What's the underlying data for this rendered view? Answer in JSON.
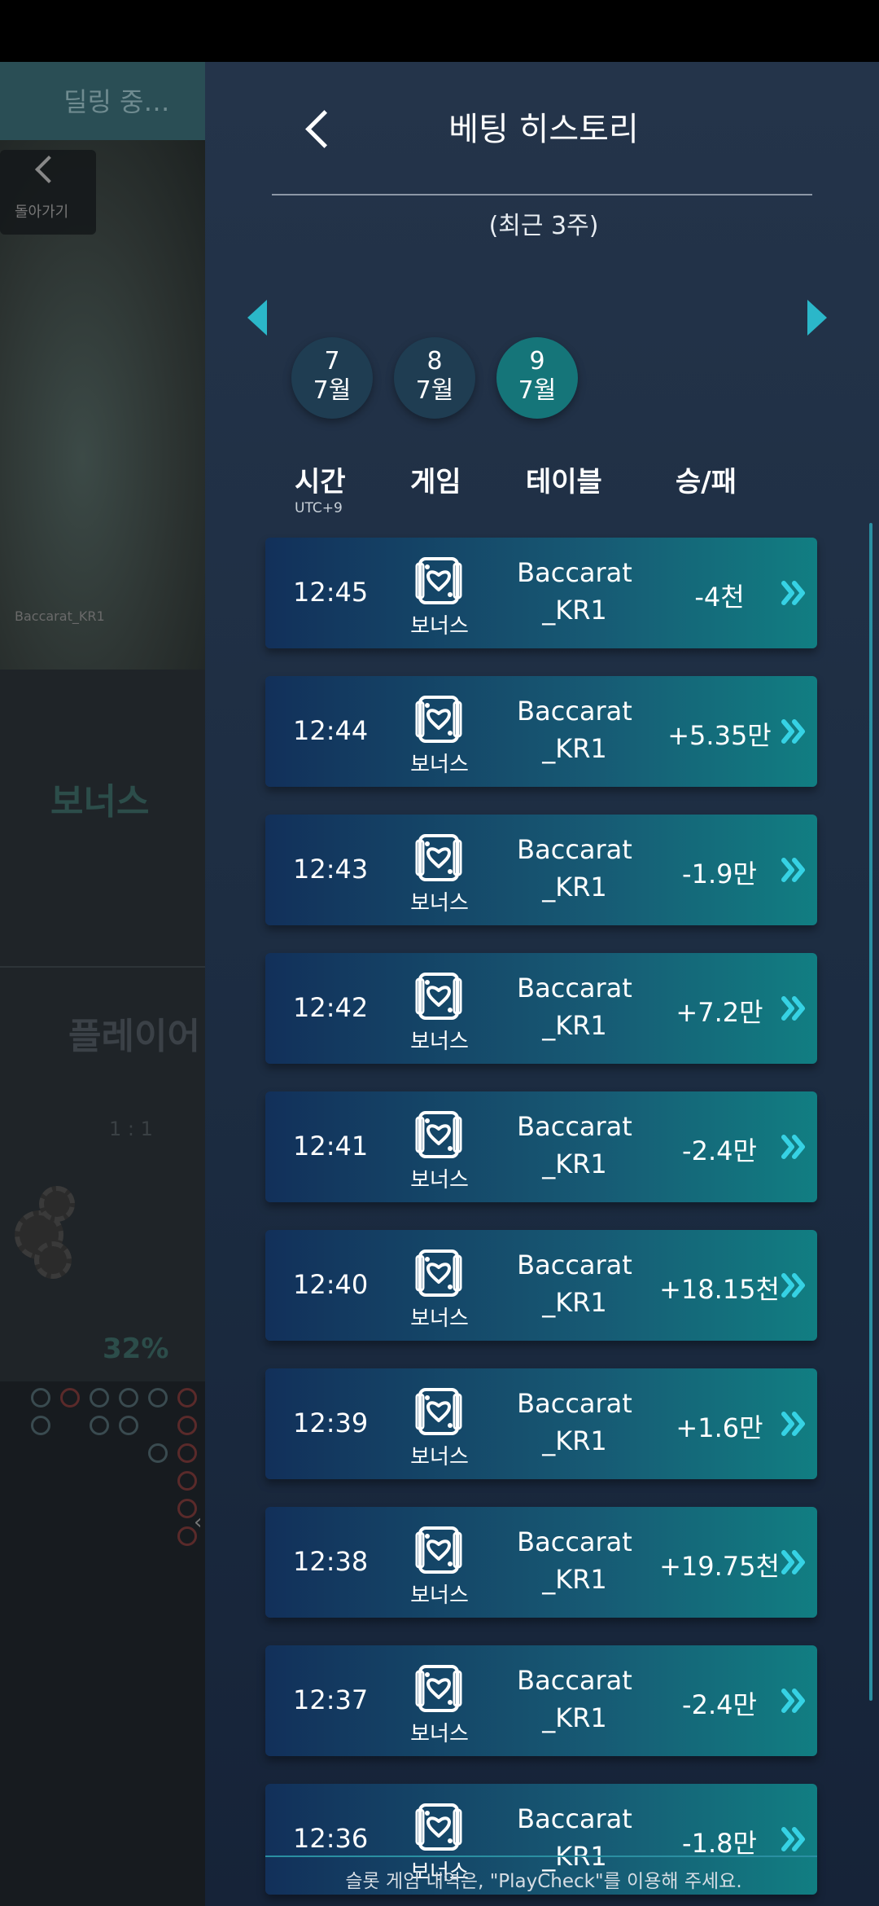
{
  "background": {
    "status_text": "딜링 중…",
    "back_label": "돌아가기",
    "table_info_line1": "Baccarat_KR1",
    "table_info_line2": "",
    "bonus_label": "보너스",
    "player_label": "플레이어",
    "payout_ratio": "1 : 1",
    "percent": "32%"
  },
  "panel": {
    "title": "베팅 히스토리",
    "subtitle": "(최근 3주)",
    "dates": [
      {
        "day": "7",
        "month": "7월",
        "selected": false
      },
      {
        "day": "8",
        "month": "7월",
        "selected": false
      },
      {
        "day": "9",
        "month": "7월",
        "selected": true
      }
    ],
    "columns": {
      "time": "시간",
      "time_zone": "UTC+9",
      "game": "게임",
      "table": "테이블",
      "result": "승/패"
    },
    "rows": [
      {
        "time": "12:45",
        "game": "보너스",
        "table_line1": "Baccarat",
        "table_line2": "_KR1",
        "result": "-4천"
      },
      {
        "time": "12:44",
        "game": "보너스",
        "table_line1": "Baccarat",
        "table_line2": "_KR1",
        "result": "+5.35만"
      },
      {
        "time": "12:43",
        "game": "보너스",
        "table_line1": "Baccarat",
        "table_line2": "_KR1",
        "result": "-1.9만"
      },
      {
        "time": "12:42",
        "game": "보너스",
        "table_line1": "Baccarat",
        "table_line2": "_KR1",
        "result": "+7.2만"
      },
      {
        "time": "12:41",
        "game": "보너스",
        "table_line1": "Baccarat",
        "table_line2": "_KR1",
        "result": "-2.4만"
      },
      {
        "time": "12:40",
        "game": "보너스",
        "table_line1": "Baccarat",
        "table_line2": "_KR1",
        "result": "+18.15천"
      },
      {
        "time": "12:39",
        "game": "보너스",
        "table_line1": "Baccarat",
        "table_line2": "_KR1",
        "result": "+1.6만"
      },
      {
        "time": "12:38",
        "game": "보너스",
        "table_line1": "Baccarat",
        "table_line2": "_KR1",
        "result": "+19.75천"
      },
      {
        "time": "12:37",
        "game": "보너스",
        "table_line1": "Baccarat",
        "table_line2": "_KR1",
        "result": "-2.4만"
      },
      {
        "time": "12:36",
        "game": "보너스",
        "table_line1": "Baccarat",
        "table_line2": "_KR1",
        "result": "-1.8만"
      }
    ],
    "footer_note": "슬롯 게임 내역은, \"PlayCheck\"를 이용해 주세요."
  },
  "colors": {
    "accent": "#2bb7c9",
    "selected_date": "#157579"
  },
  "icons": {
    "back": "chevron-left-icon",
    "game": "card-heart-icon",
    "row_detail": "double-chevron-right-icon"
  }
}
